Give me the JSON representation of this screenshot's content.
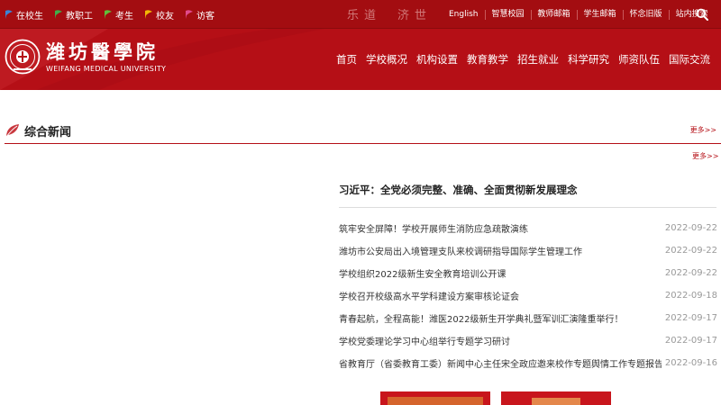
{
  "topbar": {
    "quick_links": [
      {
        "label": "在校生",
        "color": "#3a84d6"
      },
      {
        "label": "教职工",
        "color": "#3fae4a"
      },
      {
        "label": "考生",
        "color": "#5fbf3a"
      },
      {
        "label": "校友",
        "color": "#f2b705"
      },
      {
        "label": "访客",
        "color": "#e04a8c"
      }
    ],
    "slogan": [
      "乐道",
      "济世"
    ],
    "links": [
      "English",
      "智慧校园",
      "教师邮箱",
      "学生邮箱",
      "怀念旧版",
      "站内搜索"
    ],
    "search_icon": "search-icon"
  },
  "header": {
    "logo_cn": "潍坊醫學院",
    "logo_en": "WEIFANG MEDICAL UNIVERSITY",
    "nav": [
      "首页",
      "学校概况",
      "机构设置",
      "教育教学",
      "招生就业",
      "科学研究",
      "师资队伍",
      "国际交流"
    ]
  },
  "section": {
    "title": "综合新闻",
    "more": "更多>>",
    "more2": "更多>>"
  },
  "news": {
    "headline": "习近平：全党必须完整、准确、全面贯彻新发展理念",
    "items": [
      {
        "title": "筑牢安全屏障！学校开展师生消防应急疏散演练",
        "date": "2022-09-22"
      },
      {
        "title": "潍坊市公安局出入境管理支队来校调研指导国际学生管理工作",
        "date": "2022-09-22"
      },
      {
        "title": "学校组织2022级新生安全教育培训公开课",
        "date": "2022-09-22"
      },
      {
        "title": "学校召开校级高水平学科建设方案审核论证会",
        "date": "2022-09-18"
      },
      {
        "title": "青春起航，全程高能！潍医2022级新生开学典礼暨军训汇演隆重举行！",
        "date": "2022-09-17"
      },
      {
        "title": "学校党委理论学习中心组举行专题学习研讨",
        "date": "2022-09-17"
      },
      {
        "title": "省教育厅（省委教育工委）新闻中心主任宋全政应邀来校作专题舆情工作专题报告",
        "date": "2022-09-16"
      }
    ]
  },
  "colors": {
    "brand": "#b50f16",
    "topbar": "#a30d11",
    "date": "#999999"
  }
}
